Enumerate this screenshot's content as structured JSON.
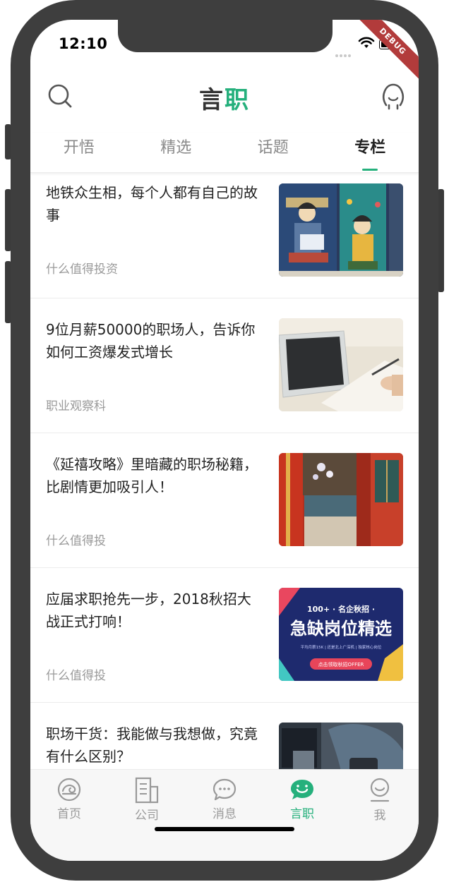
{
  "status_bar": {
    "time": "12:10",
    "debug_label": "DEBUG"
  },
  "header": {
    "title_part1": "言",
    "title_part2": "职"
  },
  "tabs": [
    {
      "label": "开悟",
      "active": false
    },
    {
      "label": "精选",
      "active": false
    },
    {
      "label": "话题",
      "active": false
    },
    {
      "label": "专栏",
      "active": true
    }
  ],
  "articles": [
    {
      "title": "地铁众生相，每个人都有自己的故事",
      "source": "什么值得投资",
      "thumb": "comic-illustration"
    },
    {
      "title": "9位月薪50000的职场人，告诉你如何工资爆发式增长",
      "source": "职业观察科",
      "thumb": "tablet-desk-photo"
    },
    {
      "title": "《延禧攻略》里暗藏的职场秘籍，比剧情更加吸引人！",
      "source": "什么值得投",
      "thumb": "palace-photo"
    },
    {
      "title": "应届求职抢先一步，2018秋招大战正式打响！",
      "source": "什么值得投",
      "thumb": "recruit-banner",
      "banner": {
        "top": "100+ · 名企秋招 ·",
        "main": "急缺岗位精选",
        "sub": "平均月薪15K | 还是北上广深机 | 独家核心岗位",
        "button": "点击领取秋招OFFER"
      }
    },
    {
      "title": "职场干货：我能做与我想做，究竟有什么区别？",
      "source": "",
      "thumb": "laptop-photo"
    }
  ],
  "bottom_nav": [
    {
      "label": "首页",
      "icon": "home-icon",
      "active": false
    },
    {
      "label": "公司",
      "icon": "company-icon",
      "active": false
    },
    {
      "label": "消息",
      "icon": "message-icon",
      "active": false
    },
    {
      "label": "言职",
      "icon": "yanzhi-icon",
      "active": true
    },
    {
      "label": "我",
      "icon": "profile-icon",
      "active": false
    }
  ],
  "colors": {
    "accent": "#25b07c",
    "text": "#222222",
    "muted": "#9a9a9a"
  }
}
